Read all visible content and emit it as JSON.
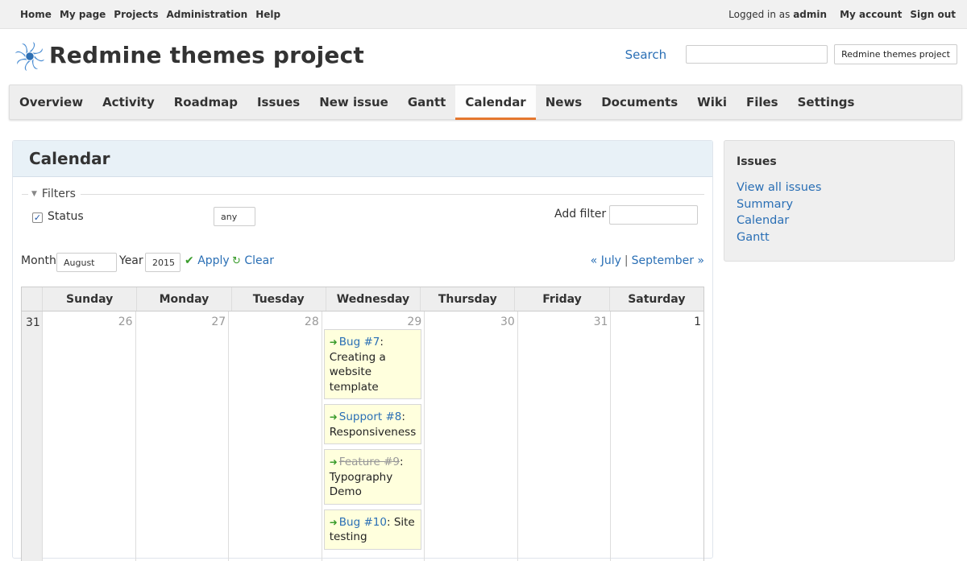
{
  "top_menu": {
    "items": [
      "Home",
      "My page",
      "Projects",
      "Administration",
      "Help"
    ],
    "logged_in_prefix": "Logged in as",
    "user": "admin",
    "my_account": "My account",
    "sign_out": "Sign out"
  },
  "header": {
    "title": "Redmine themes project",
    "search_label": "Search",
    "search_value": "",
    "project_jump": "Redmine themes project"
  },
  "main_menu": {
    "tabs": [
      "Overview",
      "Activity",
      "Roadmap",
      "Issues",
      "New issue",
      "Gantt",
      "Calendar",
      "News",
      "Documents",
      "Wiki",
      "Files",
      "Settings"
    ],
    "selected": "Calendar"
  },
  "content": {
    "title": "Calendar",
    "filters": {
      "legend": "Filters",
      "status_label": "Status",
      "status_checked": true,
      "status_operator": "any",
      "add_filter_label": "Add filter",
      "add_filter_value": ""
    },
    "period": {
      "month_label": "Month",
      "month_value": "August",
      "year_label": "Year",
      "year_value": "2015",
      "apply": "Apply",
      "clear": "Clear",
      "prev": "« July",
      "separator": "|",
      "next": "September »"
    },
    "calendar": {
      "days": [
        "Sunday",
        "Monday",
        "Tuesday",
        "Wednesday",
        "Thursday",
        "Friday",
        "Saturday"
      ],
      "week_number": "31",
      "dates": [
        "26",
        "27",
        "28",
        "29",
        "30",
        "31",
        "1"
      ],
      "issues_wednesday": [
        {
          "link": "Bug #7",
          "text": "Creating a website template",
          "closed": false
        },
        {
          "link": "Support #8",
          "text": "Responsiveness",
          "closed": false
        },
        {
          "link": "Feature #9",
          "text": "Typography Demo",
          "closed": true
        },
        {
          "link": "Bug #10",
          "text": "Site testing",
          "closed": false
        }
      ]
    }
  },
  "sidebar": {
    "title": "Issues",
    "links": [
      "View all issues",
      "Summary",
      "Calendar",
      "Gantt"
    ]
  },
  "colors": {
    "link": "#2a6fb5",
    "active_tab_underline": "#e4772e",
    "issue_bg": "#ffffdd",
    "header_bg": "#e8f1f7"
  }
}
